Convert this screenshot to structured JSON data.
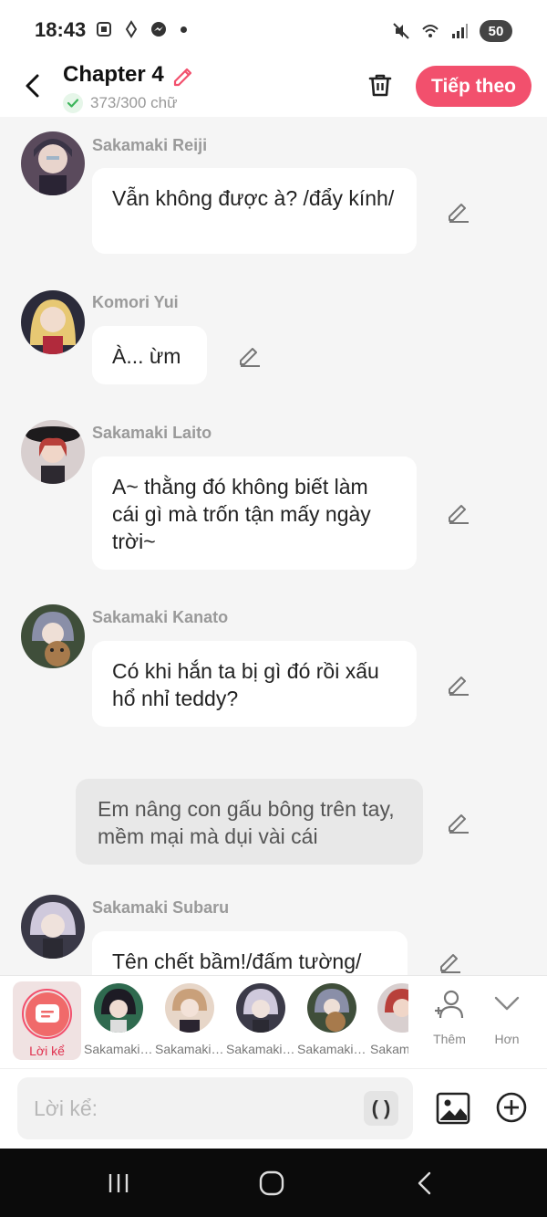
{
  "status_bar": {
    "time": "18:43",
    "battery": "50"
  },
  "header": {
    "title": "Chapter 4",
    "word_count": "373/300 chữ",
    "next_label": "Tiếp theo",
    "accent_color": "#f2506d"
  },
  "messages": [
    {
      "speaker": "Sakamaki Reiji",
      "text": "Vẫn không được à? /đẩy kính/"
    },
    {
      "speaker": "Komori Yui",
      "text": "À... ừm"
    },
    {
      "speaker": "Sakamaki Laito",
      "text": "A~ thằng đó không biết làm cái gì mà trốn tận mấy ngày trời~"
    },
    {
      "speaker": "Sakamaki Kanato",
      "text": "Có khi hắn ta bị gì đó rồi xấu hổ nhỉ teddy?"
    },
    {
      "narration": "Em nâng con gấu bông trên tay, mềm mại mà dụi vài cái"
    },
    {
      "speaker": "Sakamaki Subaru",
      "text": "Tên chết bầm!/đấm tường/"
    }
  ],
  "character_bar": {
    "narration_label": "Lời kể",
    "characters": [
      "Sakamaki ...",
      "Sakamaki ...",
      "Sakamaki ...",
      "Sakamaki ...",
      "Sakam"
    ],
    "add_label": "Thêm",
    "more_label": "Hơn"
  },
  "input_bar": {
    "placeholder": "Lời kể:",
    "paren_label": "( )"
  }
}
